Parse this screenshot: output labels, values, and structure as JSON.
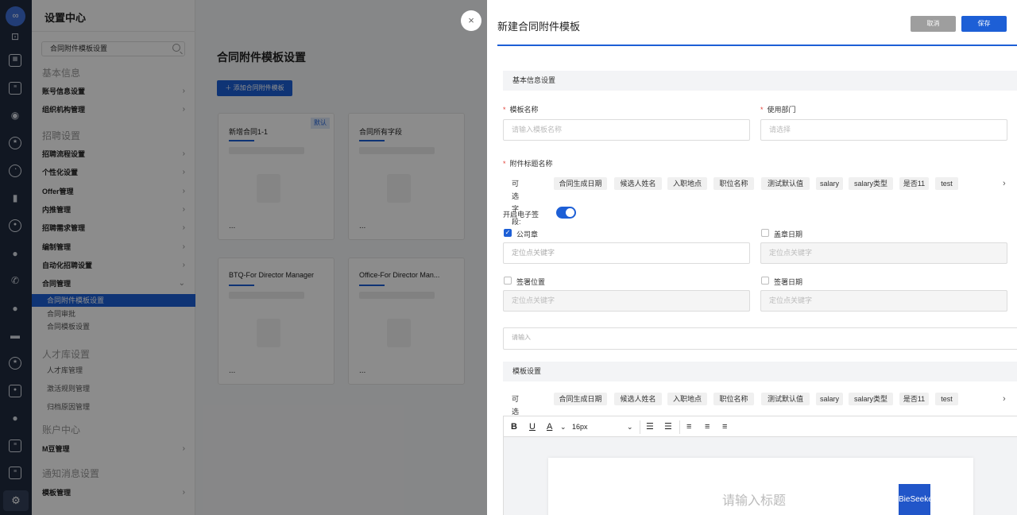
{
  "app": {
    "settings_title": "设置中心",
    "search_value": "合同附件模板设置"
  },
  "sidebar": {
    "sections": [
      "基本信息",
      "招聘设置",
      "人才库设置",
      "账户中心",
      "通知消息设置"
    ],
    "items": [
      "账号信息设置",
      "组织机构管理",
      "招聘流程设置",
      "个性化设置",
      "Offer管理",
      "内推管理",
      "招聘需求管理",
      "编制管理",
      "自动化招聘设置",
      "合同管理",
      "M豆管理",
      "模板管理"
    ],
    "subitems": [
      "合同附件模板设置",
      "合同审批",
      "合同模板设置",
      "人才库管理",
      "激活规则管理",
      "归档原因管理"
    ]
  },
  "main": {
    "title": "合同附件模板设置",
    "add_button": "＋ 添加合同附件模板",
    "cards": [
      {
        "title": "新增合同1-1",
        "badge": "默认",
        "more": "..."
      },
      {
        "title": "合同所有字段",
        "more": "..."
      },
      {
        "title": "BTQ-For Director Manager",
        "more": "..."
      },
      {
        "title": "Office-For Director Man...",
        "more": "..."
      }
    ]
  },
  "drawer": {
    "title": "新建合同附件模板",
    "cancel": "取消",
    "save": "保存",
    "close": "×",
    "basic_section": "基本信息设置",
    "template_name_label": "模板名称",
    "template_name_placeholder": "请输入模板名称",
    "dept_label": "使用部门",
    "dept_placeholder": "请选择",
    "attach_title_label": "附件标题名称",
    "fields_label": "可选字段:",
    "fields": [
      "合同生成日期",
      "候选人姓名",
      "入职地点",
      "职位名称",
      "测试默认值",
      "salary",
      "salary类型",
      "是否11",
      "test"
    ],
    "esign_label": "开启电子签",
    "esign_on": true,
    "seal_label": "公司章",
    "seal_checked": true,
    "seal_date_label": "盖章日期",
    "sign_pos_label": "签署位置",
    "sign_date_label": "签署日期",
    "keyword_placeholder": "定位点关键字",
    "textarea_placeholder": "请输入",
    "template_section": "模板设置",
    "font_size": "16px",
    "editor_title_placeholder": "请输入标题",
    "logo_text": "BieSeeker"
  }
}
